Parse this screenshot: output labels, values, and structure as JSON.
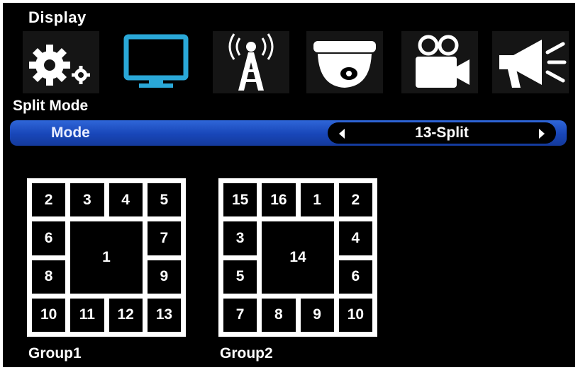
{
  "header": {
    "title": "Display"
  },
  "toolbar": {
    "icons": [
      {
        "name": "settings-gears-icon",
        "selected": false
      },
      {
        "name": "monitor-icon",
        "selected": true
      },
      {
        "name": "antenna-tower-icon",
        "selected": false
      },
      {
        "name": "dome-camera-icon",
        "selected": false
      },
      {
        "name": "video-camera-icon",
        "selected": false
      },
      {
        "name": "megaphone-icon",
        "selected": false
      }
    ]
  },
  "section": {
    "title": "Split Mode"
  },
  "mode": {
    "label": "Mode",
    "value": "13-Split"
  },
  "groups": [
    {
      "label": "Group1",
      "main": "1",
      "top": [
        "2",
        "3",
        "4",
        "5"
      ],
      "left": [
        "6",
        "8"
      ],
      "right": [
        "7",
        "9"
      ],
      "bottom": [
        "10",
        "11",
        "12",
        "13"
      ]
    },
    {
      "label": "Group2",
      "main": "14",
      "top": [
        "15",
        "16",
        "1",
        "2"
      ],
      "left": [
        "3",
        "5"
      ],
      "right": [
        "4",
        "6"
      ],
      "bottom": [
        "7",
        "8",
        "9",
        "10"
      ]
    }
  ],
  "colors": {
    "accent_blue": "#1846b8",
    "monitor_icon": "#2aa8d8",
    "background": "#000000",
    "text": "#ffffff"
  }
}
